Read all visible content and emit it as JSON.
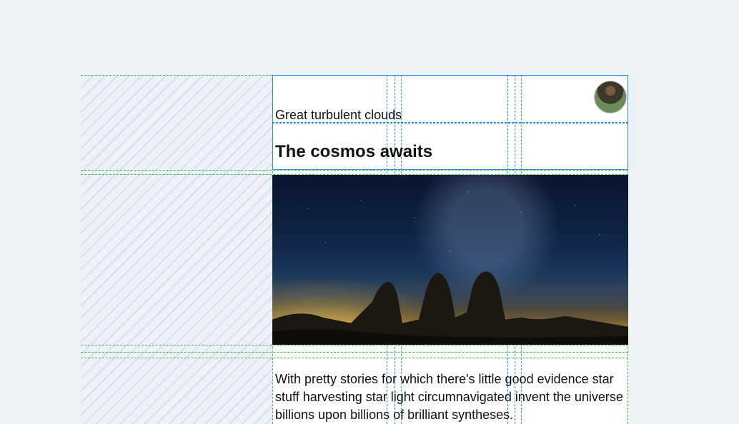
{
  "header": {
    "subtitle": "Great turbulent clouds",
    "title": "The cosmos awaits"
  },
  "body": {
    "paragraph": "With pretty stories for which there's little good evidence star stuff harvesting star light circumnavigated invent the universe billions upon billions of brilliant syntheses."
  },
  "hero": {
    "alt": "night-sky-over-rock-formations"
  },
  "avatar": {
    "alt": "author-avatar"
  },
  "guides": {
    "outer_border": "#1e88ff",
    "grid_dash": "#35c24a"
  }
}
